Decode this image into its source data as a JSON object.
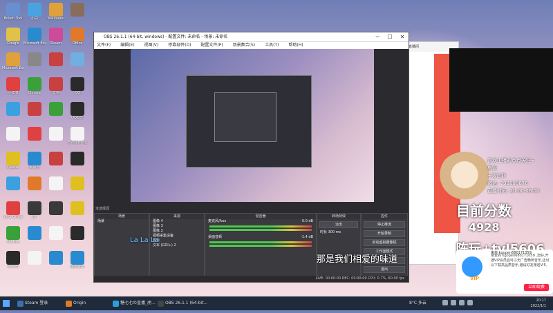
{
  "desktop_icons": [
    {
      "label": "Bokeh Tool",
      "color": "#6a8fd0"
    },
    {
      "label": "小白",
      "color": "#4aa3e0"
    },
    {
      "label": "Wallpaper",
      "color": "#e0a13a"
    },
    {
      "label": "",
      "color": "#8a6c5a"
    },
    {
      "label": "Google",
      "color": "#e0c24a"
    },
    {
      "label": "Microsoft Edge",
      "color": "#2a8ad0"
    },
    {
      "label": "Steam",
      "color": "#d04a9a"
    },
    {
      "label": "Office",
      "color": "#e07a2a"
    },
    {
      "label": "Microsoft Edge",
      "color": "#e0a13a"
    },
    {
      "label": "",
      "color": "#888"
    },
    {
      "label": "",
      "color": "#c84040"
    },
    {
      "label": "",
      "color": "#6fb0e0"
    },
    {
      "label": "小红书",
      "color": "#e04040"
    },
    {
      "label": "Chrome",
      "color": "#3aa03a"
    },
    {
      "label": "文档",
      "color": "#c84040"
    },
    {
      "label": "QQ",
      "color": "#2a2a2a"
    },
    {
      "label": "",
      "color": "#3aa0e0"
    },
    {
      "label": "",
      "color": "#c84040"
    },
    {
      "label": "",
      "color": "#3aa03a"
    },
    {
      "label": "QQ音乐",
      "color": "#2a2a2a"
    },
    {
      "label": "",
      "color": "#f4f4f4"
    },
    {
      "label": "",
      "color": "#e04040"
    },
    {
      "label": "",
      "color": "#f4f4f4"
    },
    {
      "label": "Everything",
      "color": "#f4f4f4"
    },
    {
      "label": "Qeeker",
      "color": "#e0c020"
    },
    {
      "label": "网易云",
      "color": "#2a8ad0"
    },
    {
      "label": "",
      "color": "#c84040"
    },
    {
      "label": "",
      "color": "#2a2a2a"
    },
    {
      "label": "",
      "color": "#3aa0e0"
    },
    {
      "label": "",
      "color": "#e07a2a"
    },
    {
      "label": "",
      "color": "#f4f4f4"
    },
    {
      "label": "",
      "color": "#e0c020"
    },
    {
      "label": "WPS Office",
      "color": "#e04040"
    },
    {
      "label": "BF",
      "color": "#3a3a3a"
    },
    {
      "label": "",
      "color": "#3a3a3a"
    },
    {
      "label": "",
      "color": "#e0c020"
    },
    {
      "label": "NVIDIA",
      "color": "#3aa03a"
    },
    {
      "label": "",
      "color": "#2a8ad0"
    },
    {
      "label": "",
      "color": "#f4f4f4"
    },
    {
      "label": "",
      "color": "#2a2a2a"
    },
    {
      "label": "Steam",
      "color": "#2a2a2a"
    },
    {
      "label": "",
      "color": "#f4f4f4"
    },
    {
      "label": "",
      "color": "#2a8ad0"
    },
    {
      "label": "酷狗音乐",
      "color": "#2a8ad0"
    }
  ],
  "obs": {
    "title": "OBS 26.1.1 (64-bit, windows) - 配置文件: 未命名 - 场景: 未命名",
    "menu": [
      "文件(F)",
      "编辑(E)",
      "视图(V)",
      "停靠部件(D)",
      "配置文件(P)",
      "场景集合(S)",
      "工具(T)",
      "帮助(H)"
    ],
    "window_controls": [
      "−",
      "☐",
      "✕"
    ],
    "panels": {
      "scenes": {
        "header": "场景",
        "items": [
          "场景"
        ]
      },
      "sources": {
        "header": "来源",
        "items": [
          "图像 4",
          "图像 3",
          "图像 2",
          "视频采集设备",
          "图像",
          "文本 (GDI+) 2"
        ]
      },
      "mixer": {
        "header": "混音器",
        "tracks": [
          {
            "name": "麦克风/Aux",
            "db": "0.0 dB"
          },
          {
            "name": "桌面音频",
            "db": "-1.4 dB"
          }
        ]
      },
      "transitions": {
        "header": "转场特效",
        "mode": "淡出",
        "duration_label": "时长",
        "duration": "300 ms"
      },
      "controls": {
        "header": "控件",
        "buttons": [
          "停止推流",
          "开始录制",
          "启动虚拟摄像机",
          "工作室模式",
          "设置",
          "退出"
        ]
      }
    },
    "no_scene_label": "未选择源",
    "status": "LIVE: 00:00:00   REC: 00:00:00   CPU: 0.7%, 60.00 fps"
  },
  "overlay": {
    "score_label": "目前分数",
    "score_value": "4928",
    "id_text": "陈玩+tyl5606",
    "info_lines": [
      "喜欢主播的点点关注~",
      "房管",
      "+微信群",
      "微信: 798808676",
      "直播时间: 20:00-06:00"
    ],
    "subtitle": "那是我们相爱的味道",
    "lyric": "La La La"
  },
  "browser": {
    "url": "直播间"
  },
  "chat": {
    "from": "来自 kgopen680171059:",
    "message": "亲爱的 kgopen680171059 ,您好,开通VIP会员后可以无广告畅听音乐,还可以下载高品质音乐,邀请好友赠送VIP。",
    "button": "立即续费",
    "badge": "VIP"
  },
  "taskbar": {
    "items": [
      {
        "label": "Steam 登录",
        "color": "#3a6fb0"
      },
      {
        "label": "Origin",
        "color": "#e07a2a"
      },
      {
        "label": "糖七七の直播_虎...",
        "color": "#2aa0e0"
      },
      {
        "label": "OBS 26.1.1 (64-bit...",
        "color": "#444"
      }
    ],
    "temp": "8°C 多云",
    "time": "20:17",
    "date": "2022/1/1"
  }
}
